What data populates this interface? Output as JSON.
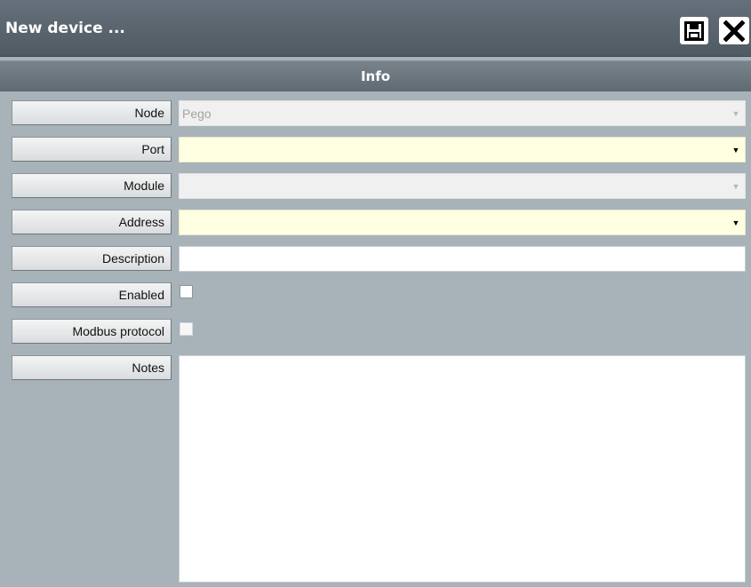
{
  "window": {
    "title": "New device ...",
    "save_icon": "floppy-disk-icon",
    "close_icon": "close-x-icon"
  },
  "section": {
    "title": "Info"
  },
  "fields": {
    "node": {
      "label": "Node",
      "value": "Pego",
      "state": "disabled",
      "type": "dropdown"
    },
    "port": {
      "label": "Port",
      "value": "",
      "state": "required",
      "type": "dropdown"
    },
    "module": {
      "label": "Module",
      "value": "",
      "state": "disabled",
      "type": "dropdown"
    },
    "address": {
      "label": "Address",
      "value": "",
      "state": "required",
      "type": "dropdown"
    },
    "description": {
      "label": "Description",
      "value": ""
    },
    "enabled": {
      "label": "Enabled",
      "checked": false
    },
    "modbus": {
      "label": "Modbus protocol",
      "checked": false,
      "state": "disabled"
    },
    "notes": {
      "label": "Notes",
      "value": ""
    }
  },
  "colors": {
    "required_bg": "#ffffe1",
    "panel_bg": "#a8b2b9",
    "titlebar": "#5a646d"
  }
}
